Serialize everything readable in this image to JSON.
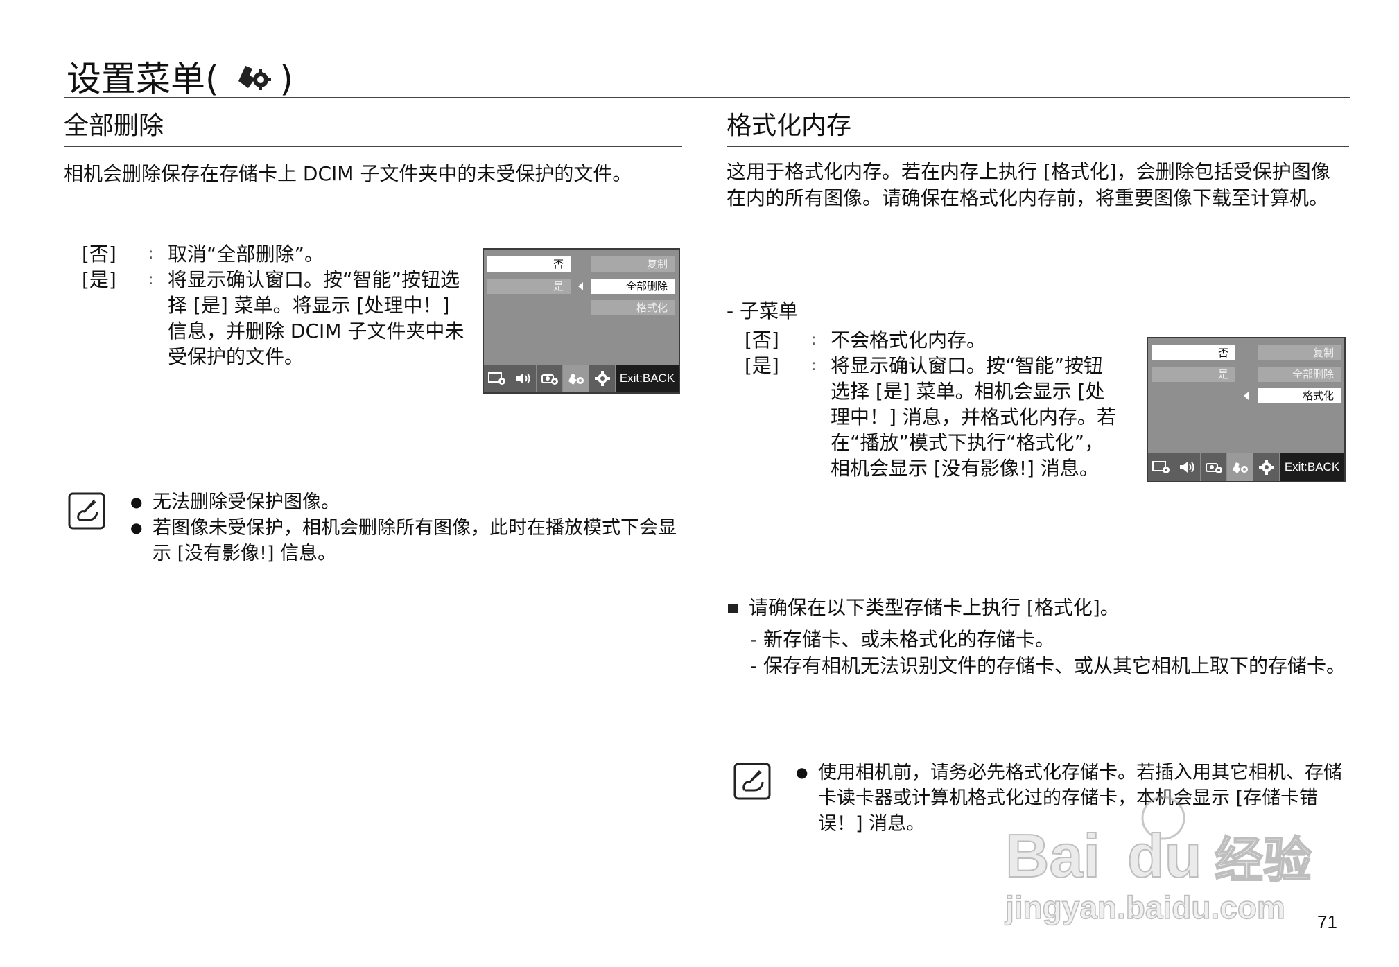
{
  "header": {
    "title_prefix": "设置菜单(",
    "title_suffix": ")",
    "icon": "setup-icon"
  },
  "left": {
    "title": "全部删除",
    "intro": "相机会删除保存在存储卡上 DCIM 子文件夹中的未受保护的文件。",
    "options": [
      {
        "key": "[否]",
        "text": "取消“全部删除”。"
      },
      {
        "key": "[是]",
        "text": "将显示确认窗口。按“智能”按钮选择 [是] 菜单。将显示 [处理中！] 信息，并删除 DCIM 子文件夹中未受保护的文件。"
      }
    ],
    "screen": {
      "left_buttons": [
        "否",
        "是"
      ],
      "right_buttons": [
        "复制",
        "全部删除",
        "格式化"
      ],
      "exit_label": "Exit:BACK"
    },
    "notes": [
      "无法删除受保护图像。",
      "若图像未受保护，相机会删除所有图像，此时在播放模式下会显示 [没有影像!] 信息。"
    ]
  },
  "right": {
    "title": "格式化内存",
    "intro": "这用于格式化内存。若在内存上执行 [格式化]，会删除包括受保护图像在内的所有图像。请确保在格式化内存前，将重要图像下载至计算机。",
    "submenu_label": "- 子菜单",
    "options": [
      {
        "key": "[否]",
        "text": "不会格式化内存。"
      },
      {
        "key": "[是]",
        "text": "将显示确认窗口。按“智能”按钮选择 [是] 菜单。相机会显示 [处理中！] 消息，并格式化内存。若在“播放”模式下执行“格式化”，相机会显示 [没有影像!] 消息。"
      }
    ],
    "screen": {
      "left_buttons": [
        "否",
        "是"
      ],
      "right_buttons": [
        "复制",
        "全部删除",
        "格式化"
      ],
      "exit_label": "Exit:BACK"
    },
    "ensure_text": "请确保在以下类型存储卡上执行 [格式化]。",
    "ensure_items": [
      "- 新存储卡、或未格式化的存储卡。",
      "- 保存有相机无法识别文件的存储卡、或从其它相机上取下的存储卡。"
    ],
    "notes": [
      "使用相机前，请务必先格式化存储卡。若插入用其它相机、存储卡读卡器或计算机格式化过的存储卡，本机会显示 [存储卡错误！] 消息。"
    ]
  },
  "watermark": {
    "line1": "Baidu经验",
    "line2": "jingyan.baidu.com"
  },
  "page_number": "71"
}
